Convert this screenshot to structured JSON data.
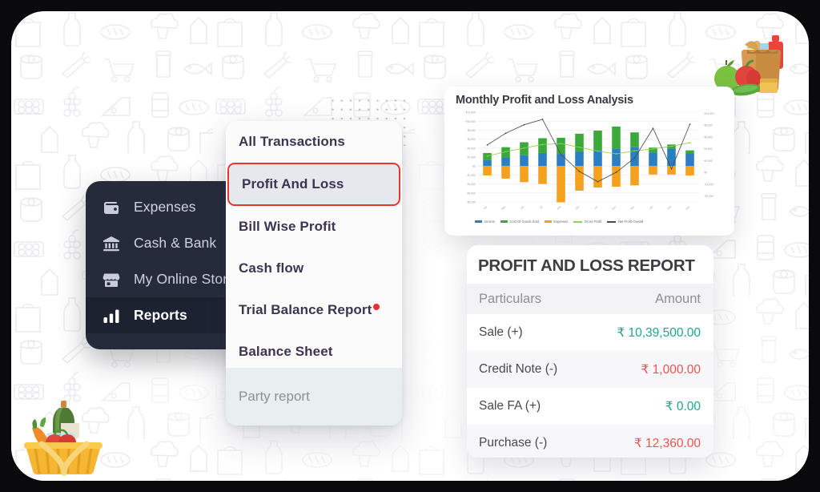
{
  "sidebar": {
    "items": [
      {
        "label": "Expenses",
        "icon": "wallet-icon",
        "active": false
      },
      {
        "label": "Cash & Bank",
        "icon": "bank-icon",
        "active": false
      },
      {
        "label": "My Online Store",
        "icon": "store-icon",
        "active": false
      },
      {
        "label": "Reports",
        "icon": "bar-chart-icon",
        "active": true
      }
    ]
  },
  "menu": {
    "items": [
      {
        "label": "All Transactions",
        "selected": false,
        "badge": false
      },
      {
        "label": "Profit And Loss",
        "selected": true,
        "badge": false
      },
      {
        "label": "Bill Wise Profit",
        "selected": false,
        "badge": false
      },
      {
        "label": "Cash flow",
        "selected": false,
        "badge": false
      },
      {
        "label": "Trial Balance Report",
        "selected": false,
        "badge": true
      },
      {
        "label": "Balance Sheet",
        "selected": false,
        "badge": false
      }
    ],
    "footer_label": "Party report",
    "selected_border_color": "#e8362f",
    "badge_color": "#ef2f2f"
  },
  "chart_data": {
    "type": "bar",
    "title": "Monthly Profit and Loss Analysis",
    "xlabel": "",
    "ylabel": "",
    "grid": true,
    "legend_position": "bottom",
    "categories": [
      "Apr",
      "May",
      "Jun",
      "Jul",
      "Aug",
      "Sep",
      "Oct",
      "Nov",
      "Dec",
      "Jan",
      "Feb",
      "Mar"
    ],
    "ylim": [
      -8000,
      12000
    ],
    "y_ticks": [
      "₹12,000",
      "₹10,000",
      "₹8,000",
      "₹6,000",
      "₹4,000",
      "₹2,000",
      "₹0",
      "-₹2,000",
      "-₹4,000",
      "-₹6,000",
      "-₹8,000"
    ],
    "y2lim": [
      -4000,
      10000
    ],
    "y2_ticks": [
      "₹10,000",
      "₹8,000",
      "₹6,000",
      "₹4,000",
      "₹2,000",
      "₹0",
      "-₹2,000",
      "-₹4,000"
    ],
    "series": [
      {
        "name": "Income",
        "type": "bar",
        "color": "#2a7fc1",
        "values": [
          1300,
          1900,
          2400,
          2900,
          2700,
          3300,
          3500,
          3900,
          4200,
          3000,
          3900,
          2800
        ]
      },
      {
        "name": "Cost Of Goods Sold",
        "type": "bar",
        "color": "#3aa93a",
        "values": [
          1600,
          2300,
          2900,
          3300,
          3600,
          3900,
          4400,
          4900,
          3300,
          1100,
          900,
          700
        ]
      },
      {
        "name": "Expenses",
        "type": "bar",
        "color": "#f5a11e",
        "values": [
          -2100,
          -2800,
          -3600,
          -4000,
          -8100,
          -5500,
          -4800,
          -4600,
          -4300,
          -1900,
          -1900,
          -2100
        ]
      },
      {
        "name": "Gross Profit",
        "type": "line",
        "color": "#92d050",
        "values": [
          2200,
          3200,
          4000,
          4800,
          5000,
          4200,
          3300,
          2700,
          3400,
          3800,
          4400,
          5200
        ]
      },
      {
        "name": "Net Profit-Overall",
        "type": "line",
        "color": "#4a4a52",
        "values": [
          4700,
          7300,
          9200,
          10400,
          2600,
          -1200,
          -3500,
          -1400,
          1800,
          8400,
          -600,
          9300
        ]
      }
    ]
  },
  "pnl": {
    "title": "PROFIT AND LOSS REPORT",
    "columns": [
      "Particulars",
      "Amount"
    ],
    "rows": [
      {
        "particulars": "Sale (+)",
        "amount": "₹ 10,39,500.00",
        "sign": "pos"
      },
      {
        "particulars": "Credit Note (-)",
        "amount": "₹ 1,000.00",
        "sign": "neg"
      },
      {
        "particulars": "Sale FA (+)",
        "amount": "₹ 0.00",
        "sign": "pos"
      },
      {
        "particulars": "Purchase (-)",
        "amount": "₹ 12,360.00",
        "sign": "neg"
      }
    ],
    "positive_color": "#19a98d",
    "negative_color": "#ef5350"
  },
  "decor": {
    "top_right": "grocery-bag-illustration",
    "bottom_left": "grocery-basket-illustration",
    "background": "grocery-line-art-pattern"
  }
}
